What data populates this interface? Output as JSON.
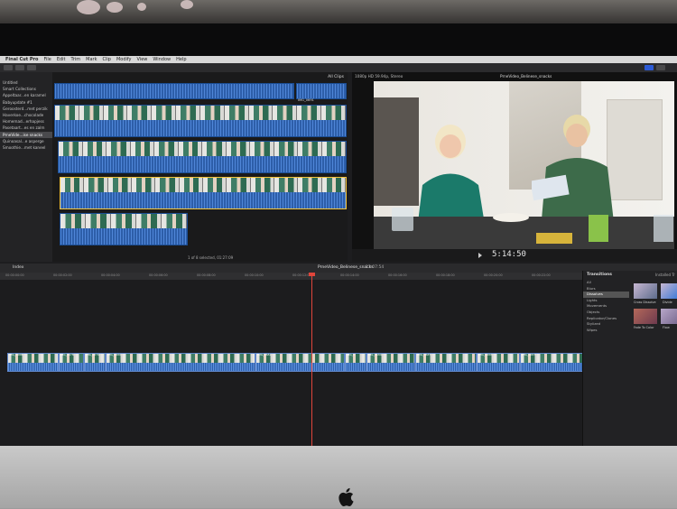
{
  "menu": {
    "app": "Final Cut Pro",
    "items": [
      "File",
      "Edit",
      "Trim",
      "Mark",
      "Clip",
      "Modify",
      "View",
      "Window",
      "Help"
    ]
  },
  "library": {
    "items": [
      {
        "label": "Untitled",
        "selected": false
      },
      {
        "label": "Smart Collections",
        "selected": false
      },
      {
        "label": "Appeltaar...en karamel",
        "selected": false
      },
      {
        "label": "Babyupdate #1",
        "selected": false
      },
      {
        "label": "Geroosterd...met perzik",
        "selected": false
      },
      {
        "label": "Haverkoe...chocolade",
        "selected": false
      },
      {
        "label": "Homemad...erhapjess",
        "selected": false
      },
      {
        "label": "Pasetaart...es en zalm",
        "selected": false
      },
      {
        "label": "PrneVide...ise snacks",
        "selected": true
      },
      {
        "label": "Quinoasal...e asperge",
        "selected": false
      },
      {
        "label": "Smoothie...met kaneel",
        "selected": false
      }
    ]
  },
  "browser": {
    "filter": "All Clips",
    "clip_label": "IMG_0691",
    "footer": "1 of 8 selected, 01:27:09"
  },
  "viewer": {
    "format": "1080p HD 59.94p, Stereo",
    "title": "PrneVideo_Belinese_snacks",
    "timecode": "5:14:50"
  },
  "timeline": {
    "index_label": "Index",
    "project_name": "PrneVideo_Belinese_snacks",
    "duration": "13:07:54",
    "ruler": [
      "00:00:00:00",
      "00:00:02:00",
      "00:00:04:00",
      "00:00:06:00",
      "00:00:08:00",
      "00:00:10:00",
      "00:00:12:00",
      "00:00:14:00",
      "00:00:16:00",
      "00:00:18:00",
      "00:00:20:00",
      "00:00:22:00"
    ],
    "clips": [
      {
        "name": "IMG_0688",
        "weight": 50
      },
      {
        "name": "IMG_0678",
        "weight": 24
      },
      {
        "name": "IMG_0679",
        "weight": 20
      },
      {
        "name": "IMG_0680",
        "weight": 150
      },
      {
        "name": "IMG_0682",
        "weight": 88
      },
      {
        "name": "IMG_0",
        "weight": 20
      },
      {
        "name": "IMG_0684",
        "weight": 48
      },
      {
        "name": "IMG_0685",
        "weight": 60
      },
      {
        "name": "IMG_0686",
        "weight": 42
      },
      {
        "name": "IMG_0687",
        "weight": 62
      }
    ]
  },
  "transitions": {
    "title": "Transitions",
    "installed": "Installed Tr",
    "categories": [
      {
        "label": "All",
        "selected": false
      },
      {
        "label": "Blurs",
        "selected": false
      },
      {
        "label": "Dissolves",
        "selected": true
      },
      {
        "label": "Lights",
        "selected": false
      },
      {
        "label": "Movements",
        "selected": false
      },
      {
        "label": "Objects",
        "selected": false
      },
      {
        "label": "Replicator/Clones",
        "selected": false
      },
      {
        "label": "Stylized",
        "selected": false
      },
      {
        "label": "Wipes",
        "selected": false
      }
    ],
    "thumbs": [
      {
        "label": "Cross Dissolve"
      },
      {
        "label": "Divide"
      },
      {
        "label": "Fade To Color"
      },
      {
        "label": "Flow"
      }
    ]
  }
}
